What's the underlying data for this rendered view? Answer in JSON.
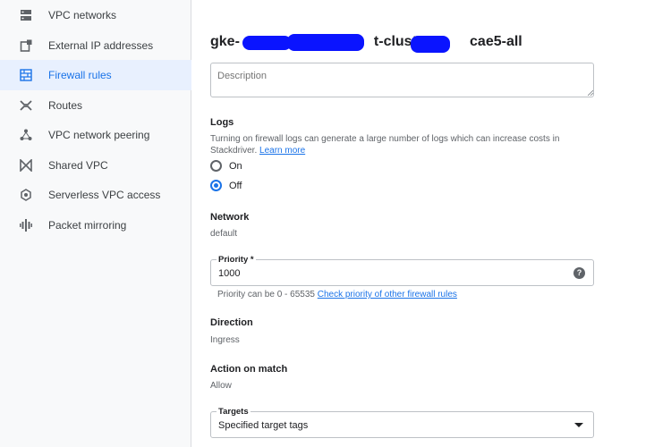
{
  "sidebar": {
    "items": [
      {
        "label": "VPC networks",
        "icon": "vpc-networks-icon"
      },
      {
        "label": "External IP addresses",
        "icon": "external-ip-icon"
      },
      {
        "label": "Firewall rules",
        "icon": "firewall-icon",
        "active": true
      },
      {
        "label": "Routes",
        "icon": "routes-icon"
      },
      {
        "label": "VPC network peering",
        "icon": "peering-icon"
      },
      {
        "label": "Shared VPC",
        "icon": "shared-vpc-icon"
      },
      {
        "label": "Serverless VPC access",
        "icon": "serverless-icon"
      },
      {
        "label": "Packet mirroring",
        "icon": "packet-mirroring-icon"
      }
    ]
  },
  "rule": {
    "title_prefix": "gke-",
    "title_middle": "t-cluster",
    "title_suffix": "cae5-all"
  },
  "description": {
    "placeholder": "Description"
  },
  "logs": {
    "label": "Logs",
    "help": "Turning on firewall logs can generate a large number of logs which can increase costs in Stackdriver.",
    "learn_more": "Learn more",
    "on_label": "On",
    "off_label": "Off",
    "selected": "Off"
  },
  "network": {
    "label": "Network",
    "value": "default"
  },
  "priority": {
    "label": "Priority *",
    "value": "1000",
    "help": "Priority can be 0 - 65535",
    "help_link": "Check priority of other firewall rules"
  },
  "direction": {
    "label": "Direction",
    "value": "Ingress"
  },
  "action": {
    "label": "Action on match",
    "value": "Allow"
  },
  "targets": {
    "label": "Targets",
    "value": "Specified target tags"
  },
  "colors": {
    "accent": "#1a73e8",
    "active_bg": "#e8f0fe",
    "redaction": "#0a14ff"
  }
}
